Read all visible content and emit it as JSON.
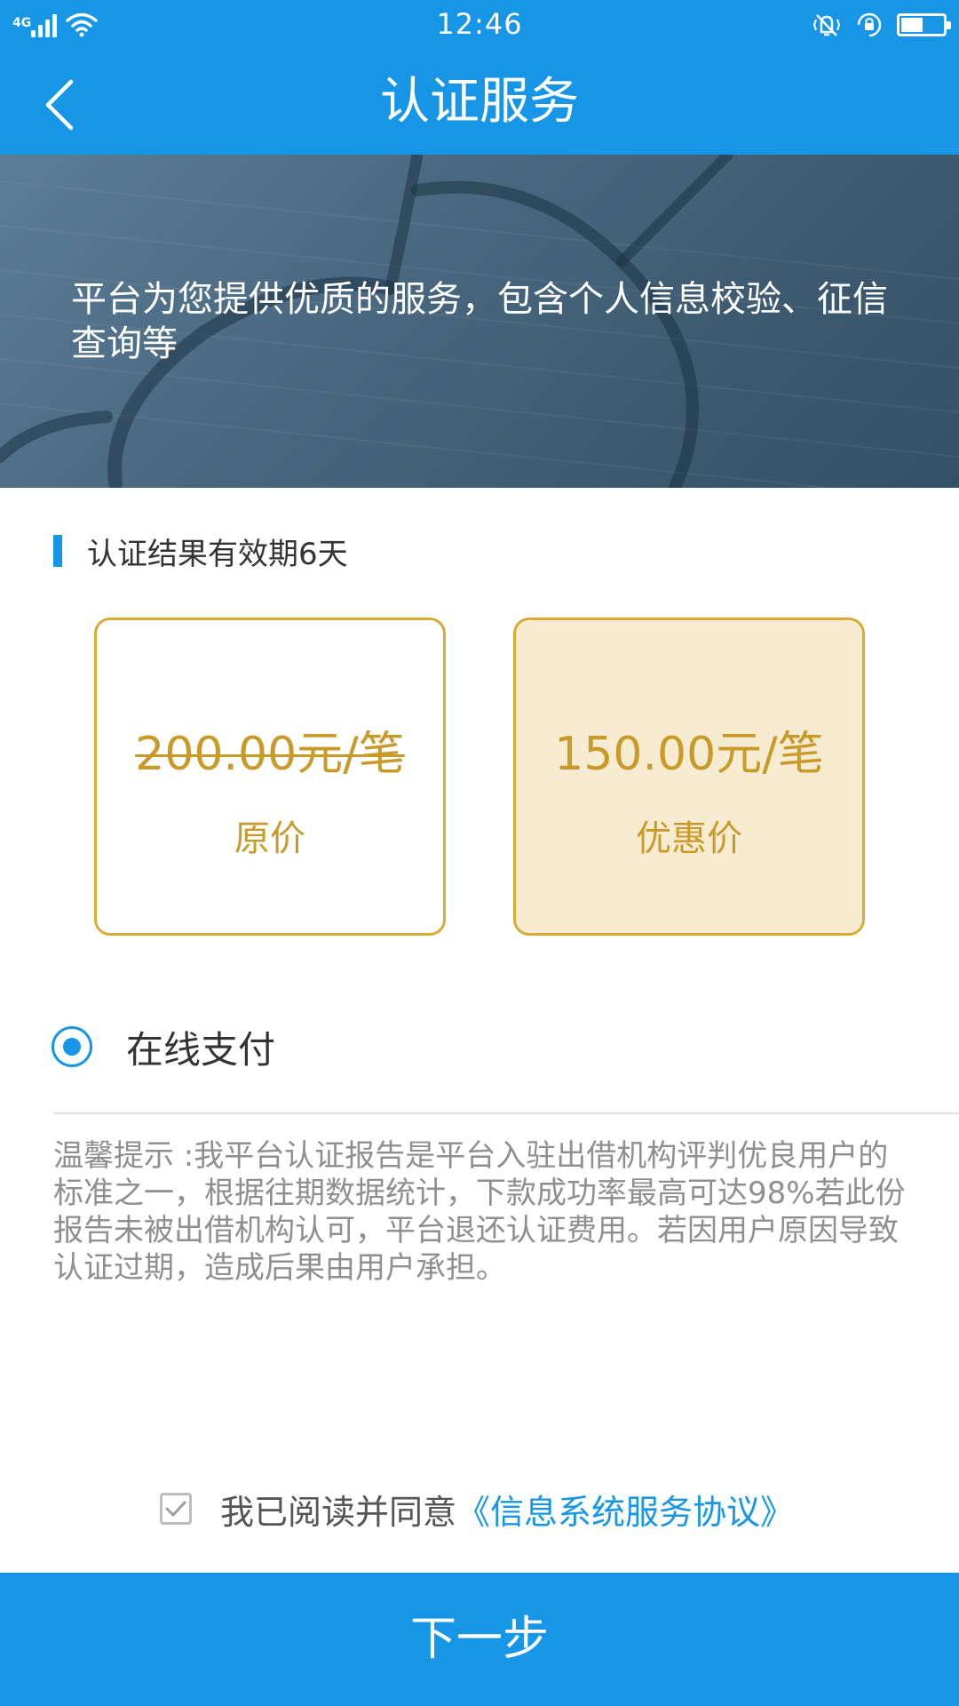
{
  "status_bar": {
    "network": "4G",
    "time": "12:46",
    "battery_level": 0.55,
    "icons": [
      "signal-icon",
      "wifi-icon",
      "vibrate-mute-icon",
      "rotation-lock-icon",
      "battery-icon"
    ]
  },
  "header": {
    "title": "认证服务",
    "back_icon": "chevron-left-icon"
  },
  "banner": {
    "text": "平台为您提供优质的服务，包含个人信息校验、征信查询等"
  },
  "validity": {
    "text": "认证结果有效期6天"
  },
  "prices": {
    "original": {
      "value": "200.00元/笔",
      "label": "原价"
    },
    "discount": {
      "value": "150.00元/笔",
      "label": "优惠价"
    }
  },
  "payment": {
    "label": "在线支付",
    "selected": true
  },
  "tip": {
    "text": "温馨提示 :我平台认证报告是平台入驻出借机构评判优良用户的标准之一，根据往期数据统计，下款成功率最高可达98%若此份报告未被出借机构认可，平台退还认证费用。若因用户原因导致认证过期，造成后果由用户承担。"
  },
  "agreement": {
    "text": "我已阅读并同意",
    "link": "《信息系统服务协议》",
    "checked": true
  },
  "next_button": {
    "label": "下一步"
  },
  "colors": {
    "primary": "#1796e8",
    "gold": "#c99a28",
    "gold_border": "#d8ac34",
    "discount_bg": "#f7ecd1",
    "muted_text": "#8f8f8f"
  }
}
